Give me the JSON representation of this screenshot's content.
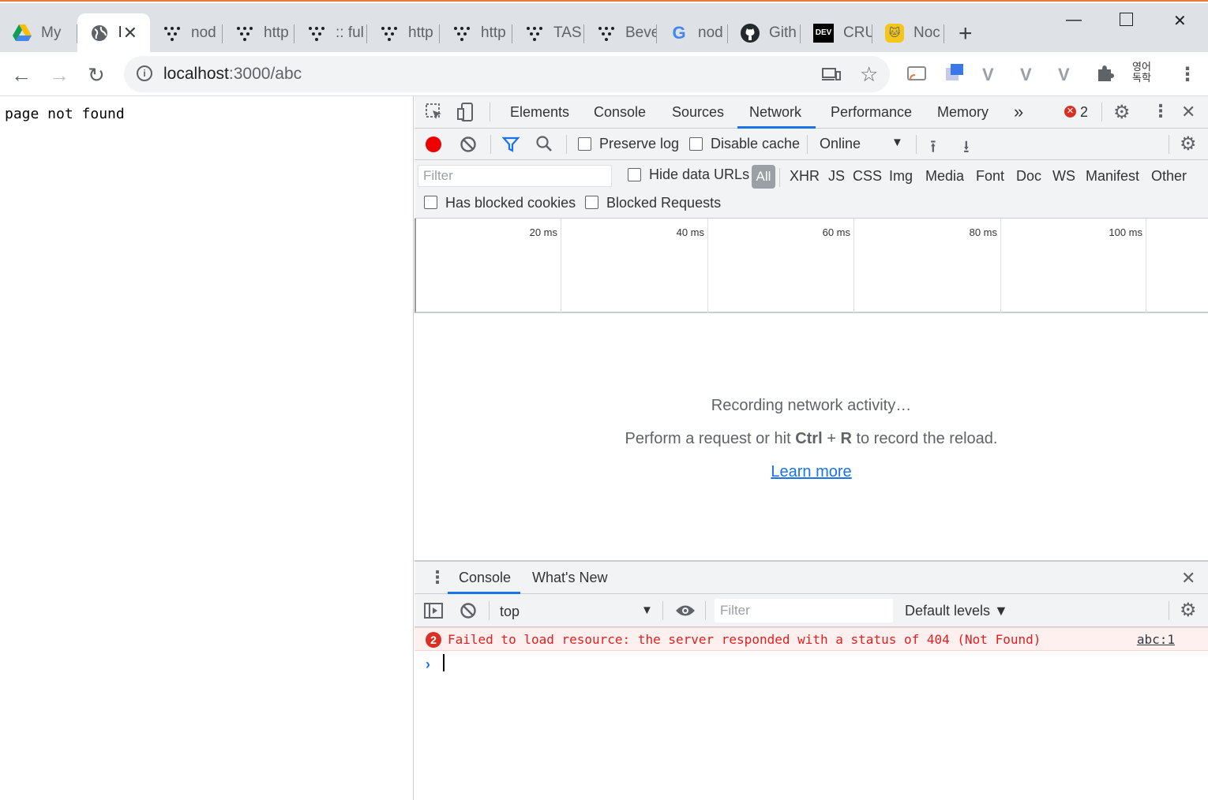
{
  "tabs": [
    {
      "label": "My",
      "icon": "google-drive-icon"
    },
    {
      "label": "l",
      "icon": "globe-icon",
      "active": true
    },
    {
      "label": "nod",
      "icon": "dots-icon"
    },
    {
      "label": "http",
      "icon": "dots-icon"
    },
    {
      "label": ":: ful",
      "icon": "dots-icon"
    },
    {
      "label": "http",
      "icon": "dots-icon"
    },
    {
      "label": "http",
      "icon": "dots-icon"
    },
    {
      "label": "TAS",
      "icon": "dots-icon"
    },
    {
      "label": "Beve",
      "icon": "dots-icon"
    },
    {
      "label": "nod",
      "icon": "google-icon"
    },
    {
      "label": "Gith",
      "icon": "github-icon"
    },
    {
      "label": "CRU",
      "icon": "dev-icon"
    },
    {
      "label": "Noc",
      "icon": "cat-icon"
    }
  ],
  "address": {
    "host": "localhost",
    "path": ":3000/abc"
  },
  "ext_badge": "영어\n독학",
  "page": {
    "message": "page not found"
  },
  "devtools": {
    "tabs": [
      "Elements",
      "Console",
      "Sources",
      "Network",
      "Performance",
      "Memory"
    ],
    "more": "»",
    "error_count": "2",
    "network_toolbar": {
      "preserve_log": "Preserve log",
      "disable_cache": "Disable cache",
      "throttle": "Online"
    },
    "filter": {
      "placeholder": "Filter",
      "hide_data_urls": "Hide data URLs",
      "all": "All",
      "types": [
        "XHR",
        "JS",
        "CSS",
        "Img",
        "Media",
        "Font",
        "Doc",
        "WS",
        "Manifest",
        "Other"
      ],
      "has_blocked_cookies": "Has blocked cookies",
      "blocked_requests": "Blocked Requests"
    },
    "timeline_ticks": [
      "20 ms",
      "40 ms",
      "60 ms",
      "80 ms",
      "100 ms"
    ],
    "empty": {
      "line1": "Recording network activity…",
      "line2_pre": "Perform a request or hit ",
      "line2_ctrl": "Ctrl",
      "line2_plus": " + ",
      "line2_r": "R",
      "line2_post": " to record the reload.",
      "learn_more": "Learn more"
    },
    "drawer": {
      "console": "Console",
      "whats_new": "What's New"
    },
    "console": {
      "context": "top",
      "filter_placeholder": "Filter",
      "levels": "Default levels ▼",
      "error_badge": "2",
      "error_text": "Failed to load resource: the server responded with a status of 404 (Not Found)",
      "error_source": "abc:1",
      "prompt": "›"
    }
  }
}
